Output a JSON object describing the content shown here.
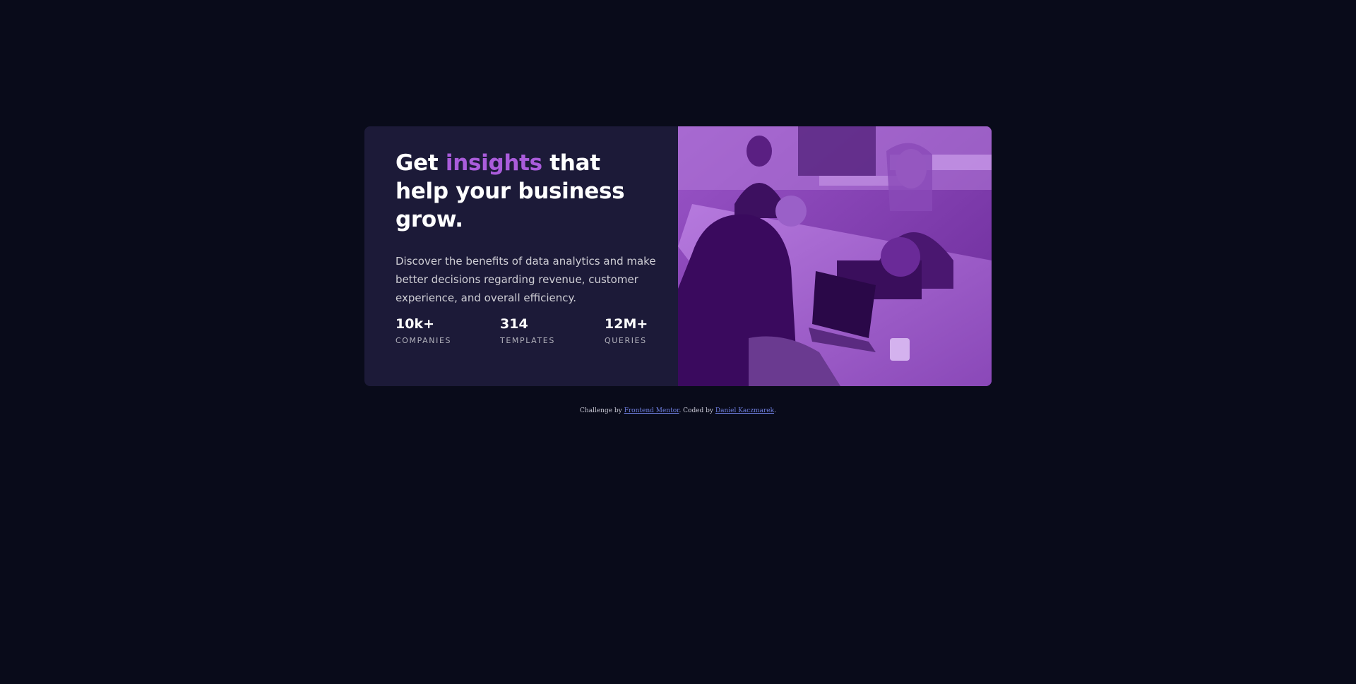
{
  "hero": {
    "title_prefix": "Get ",
    "title_accent": "insights",
    "title_suffix": " that help your business grow.",
    "description": "Discover the benefits of data analytics and make better decisions regarding revenue, customer experience, and overall efficiency."
  },
  "stats": [
    {
      "value": "10k+",
      "label": "COMPANIES"
    },
    {
      "value": "314",
      "label": "TEMPLATES"
    },
    {
      "value": "12M+",
      "label": "QUERIES"
    }
  ],
  "image": {
    "icon": "office-team-photo"
  },
  "footer": {
    "challenge_text": "Challenge by ",
    "challenge_link": "Frontend Mentor",
    "coded_text": ". Coded by ",
    "author_link": "Daniel Kaczmarek",
    "end_text": "."
  },
  "colors": {
    "background": "#090b1a",
    "card": "#1c1a38",
    "accent": "#aa5cdb",
    "image_overlay": "#8a3fc0",
    "link": "#6f7fe0"
  }
}
